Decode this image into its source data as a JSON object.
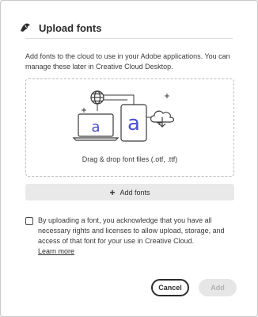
{
  "dialog": {
    "title": "Upload fonts",
    "description": "Add fonts to the cloud to use in your Adobe applications. You can manage these later in Creative Cloud Desktop.",
    "dropzone": {
      "text": "Drag & drop font files (.otf, .ttf)",
      "icons": [
        "globe-icon",
        "laptop-icon",
        "tablet-icon",
        "cloud-download-icon",
        "font-a-icon"
      ]
    },
    "add_fonts": {
      "icon": "plus-icon",
      "plus_glyph": "+",
      "label": "Add fonts"
    },
    "consent": {
      "checked": false,
      "text": "By uploading a font, you acknowledge that you have all necessary rights and licenses to allow upload, storage, and access of that font for your use in Creative Cloud.",
      "learn_more": "Learn more"
    },
    "buttons": {
      "cancel": "Cancel",
      "add": "Add"
    }
  },
  "colors": {
    "accent_font_icon": "#4a4ed8",
    "text": "#2c2c2c",
    "disabled_text": "#b3b3b3"
  }
}
